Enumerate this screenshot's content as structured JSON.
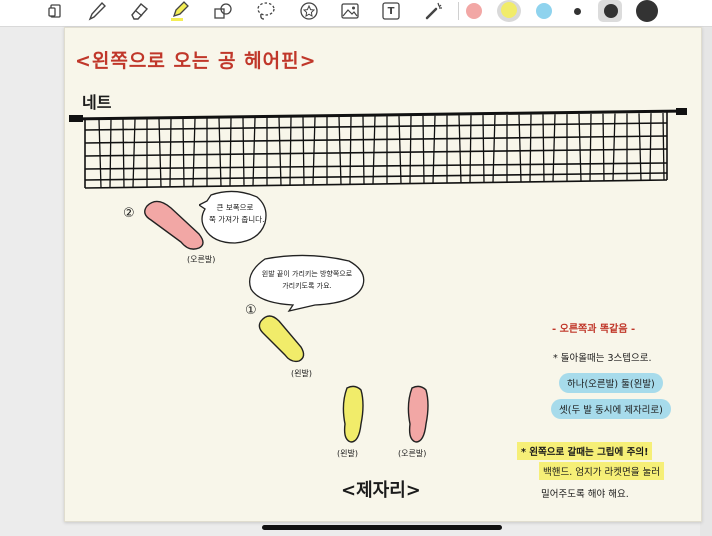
{
  "toolbar": {
    "tools": [
      {
        "name": "page-icon"
      },
      {
        "name": "pen-icon"
      },
      {
        "name": "eraser-icon"
      },
      {
        "name": "highlighter-icon"
      },
      {
        "name": "shapes-icon"
      },
      {
        "name": "lasso-icon"
      },
      {
        "name": "sticker-icon"
      },
      {
        "name": "image-icon"
      },
      {
        "name": "text-icon"
      },
      {
        "name": "laser-pointer-icon"
      }
    ],
    "text_tool_glyph": "T",
    "colors": [
      "#f2a7a5",
      "#f1ec6a",
      "#8fd3ee"
    ],
    "sizes": [
      "small",
      "medium",
      "large"
    ]
  },
  "note": {
    "title": "<왼쪽으로 오는 공 헤어핀>",
    "net_label": "네트",
    "step2": {
      "number": "②",
      "bubble": [
        "큰 보폭으로",
        "쭉 가져가 줍니다."
      ],
      "foot_label": "(오른발)"
    },
    "step1": {
      "number": "①",
      "bubble": [
        "왼발 끝이 가리키는 방향쪽으로",
        "가리키도록 가요."
      ],
      "foot_label": "(왼발)"
    },
    "home": {
      "left_label": "(왼발)",
      "right_label": "(오른발)",
      "caption": "<제자리>"
    },
    "side_notes": {
      "heading": "- 오른쪽과 똑같음 -",
      "line1": "* 돌아올때는 3스텝으로.",
      "line2": "하나(오른발) 둘(왼발)",
      "line3": "셋(두 발 동시에 제자리로)",
      "warn": "* 왼쪽으로 갈때는 그립에 주의!",
      "tip1": "백핸드. 엄지가 라켓면을 눌러",
      "tip2": "밀어주도록 해야 해요."
    }
  }
}
